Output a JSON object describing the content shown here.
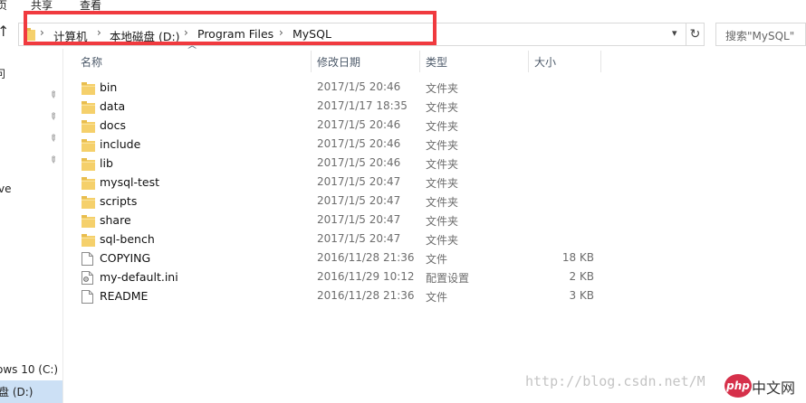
{
  "ribbon": {
    "tabs": [
      {
        "label": "页"
      },
      {
        "label": "共享"
      },
      {
        "label": "查看"
      }
    ]
  },
  "address": {
    "breadcrumbs": [
      "计算机",
      "本地磁盘 (D:)",
      "Program Files",
      "MySQL"
    ],
    "separator": "›",
    "search_placeholder": "搜索\"MySQL\""
  },
  "navpane": {
    "items": [
      "问",
      "ve",
      "ows 10 (C:)",
      "盘 (D:)"
    ]
  },
  "columns": {
    "name": "名称",
    "date": "修改日期",
    "type": "类型",
    "size": "大小"
  },
  "files": [
    {
      "name": "bin",
      "date": "2017/1/5 20:46",
      "type": "文件夹",
      "size": "",
      "kind": "folder"
    },
    {
      "name": "data",
      "date": "2017/1/17 18:35",
      "type": "文件夹",
      "size": "",
      "kind": "folder"
    },
    {
      "name": "docs",
      "date": "2017/1/5 20:46",
      "type": "文件夹",
      "size": "",
      "kind": "folder"
    },
    {
      "name": "include",
      "date": "2017/1/5 20:46",
      "type": "文件夹",
      "size": "",
      "kind": "folder"
    },
    {
      "name": "lib",
      "date": "2017/1/5 20:46",
      "type": "文件夹",
      "size": "",
      "kind": "folder"
    },
    {
      "name": "mysql-test",
      "date": "2017/1/5 20:47",
      "type": "文件夹",
      "size": "",
      "kind": "folder"
    },
    {
      "name": "scripts",
      "date": "2017/1/5 20:47",
      "type": "文件夹",
      "size": "",
      "kind": "folder"
    },
    {
      "name": "share",
      "date": "2017/1/5 20:47",
      "type": "文件夹",
      "size": "",
      "kind": "folder"
    },
    {
      "name": "sql-bench",
      "date": "2017/1/5 20:47",
      "type": "文件夹",
      "size": "",
      "kind": "folder"
    },
    {
      "name": "COPYING",
      "date": "2016/11/28 21:36",
      "type": "文件",
      "size": "18 KB",
      "kind": "file"
    },
    {
      "name": "my-default.ini",
      "date": "2016/11/29 10:12",
      "type": "配置设置",
      "size": "2 KB",
      "kind": "ini"
    },
    {
      "name": "README",
      "date": "2016/11/28 21:36",
      "type": "文件",
      "size": "3 KB",
      "kind": "file"
    }
  ],
  "watermark": {
    "url": "http://blog.csdn.net/M",
    "logo_badge": "php",
    "logo_text": "中文网"
  },
  "colors": {
    "highlight": "#f03a3f",
    "folder": "#f5d06b",
    "selected": "#cce0f5"
  }
}
